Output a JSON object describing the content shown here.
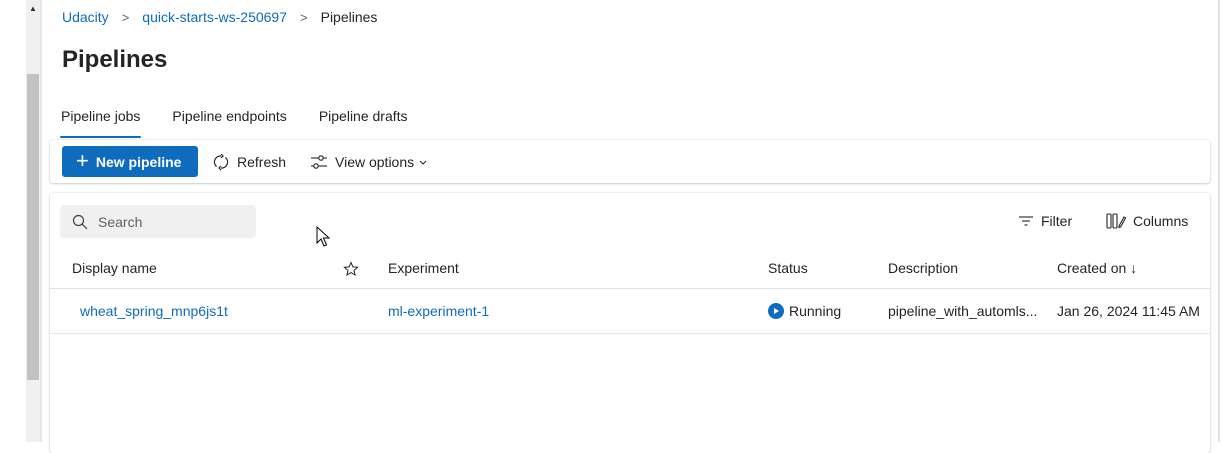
{
  "breadcrumb": {
    "items": [
      "Udacity",
      "quick-starts-ws-250697"
    ],
    "current": "Pipelines",
    "separator": ">"
  },
  "page": {
    "title": "Pipelines"
  },
  "tabs": [
    {
      "label": "Pipeline jobs",
      "active": true
    },
    {
      "label": "Pipeline endpoints",
      "active": false
    },
    {
      "label": "Pipeline drafts",
      "active": false
    }
  ],
  "toolbar": {
    "new_label": "New pipeline",
    "refresh_label": "Refresh",
    "view_options_label": "View options"
  },
  "grid": {
    "search_placeholder": "Search",
    "filter_label": "Filter",
    "columns_label": "Columns",
    "headers": {
      "display_name": "Display name",
      "experiment": "Experiment",
      "status": "Status",
      "description": "Description",
      "created_on": "Created on ↓"
    },
    "rows": [
      {
        "display_name": "wheat_spring_mnp6js1t",
        "experiment": "ml-experiment-1",
        "status": "Running",
        "description": "pipeline_with_automls...",
        "created_on": "Jan 26, 2024 11:45 AM"
      }
    ]
  },
  "colors": {
    "accent": "#0f6cbd",
    "text": "#242424"
  }
}
